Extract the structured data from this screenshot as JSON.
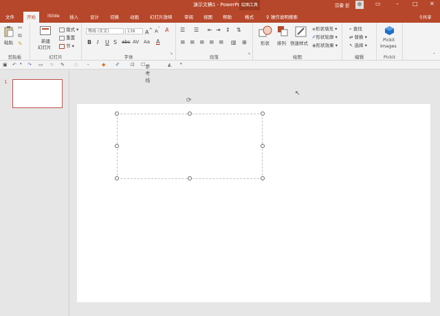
{
  "window": {
    "title": "演示文稿1 - PowerPoint",
    "context_tab": "绘图工具",
    "user": "宗豪 彭"
  },
  "tabs": [
    "文件",
    "开始",
    "iSlide",
    "插入",
    "设计",
    "切换",
    "动画",
    "幻灯片放映",
    "审阅",
    "视图",
    "帮助",
    "格式"
  ],
  "tell_me": "操作说明搜索",
  "share": "共享",
  "ribbon": {
    "clipboard": {
      "paste": "粘贴",
      "label": "剪贴板"
    },
    "slides": {
      "new_slide_line1": "新建",
      "new_slide_line2": "幻灯片",
      "layout": "版式",
      "reset": "重置",
      "section": "节",
      "label": "幻灯片"
    },
    "font": {
      "font_name": "等线 (正文)",
      "font_size": "138",
      "label": "字体"
    },
    "paragraph": {
      "label": "段落"
    },
    "drawing": {
      "shapes": "形状",
      "arrange": "排列",
      "quick_styles": "快速样式",
      "fill": "形状填充",
      "outline": "形状轮廓",
      "effects": "形状效果",
      "label": "绘图"
    },
    "editing": {
      "find": "查找",
      "replace": "替换",
      "select": "选择",
      "label": "编辑"
    },
    "pickit": {
      "line1": "Pickit",
      "line2": "Images",
      "label": "Pickit"
    }
  },
  "qat": {
    "guides": "参考线"
  },
  "slides_pane": {
    "current": "1"
  },
  "colors": {
    "accent": "#b7472a",
    "accent_dark": "#9a3a20",
    "selection": "#c0504d"
  }
}
